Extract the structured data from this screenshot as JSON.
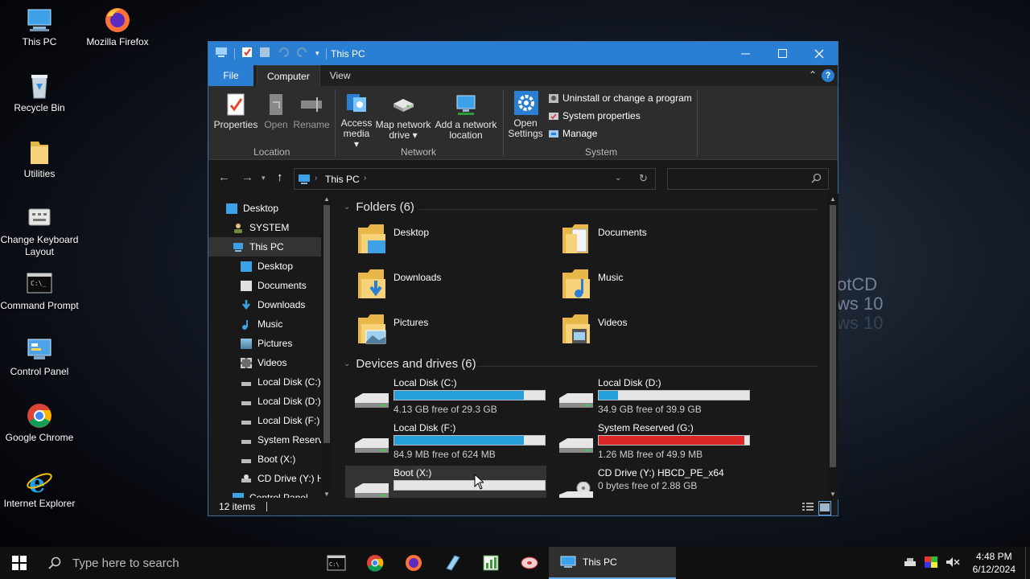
{
  "desktop": {
    "wallpaper_text": [
      "otCD",
      "ws 10",
      "ws 10"
    ],
    "icons": [
      {
        "label": "This PC",
        "icon": "this-pc-icon"
      },
      {
        "label": "Mozilla Firefox",
        "icon": "firefox-icon"
      },
      {
        "label": "Recycle Bin",
        "icon": "recycle-bin-icon"
      },
      {
        "label": "Utilities",
        "icon": "folder-icon"
      },
      {
        "label": "Change Keyboard Layout",
        "icon": "keyboard-icon"
      },
      {
        "label": "Command Prompt",
        "icon": "command-prompt-icon"
      },
      {
        "label": "Control Panel",
        "icon": "control-panel-icon"
      },
      {
        "label": "Google Chrome",
        "icon": "chrome-icon"
      },
      {
        "label": "Internet Explorer",
        "icon": "internet-explorer-icon"
      }
    ]
  },
  "window": {
    "title": "This PC",
    "tabs": {
      "file": "File",
      "computer": "Computer",
      "view": "View"
    },
    "ribbon": {
      "location": {
        "properties": "Properties",
        "open": "Open",
        "rename": "Rename",
        "group": "Location"
      },
      "network": {
        "access_media_1": "Access",
        "access_media_2": "media",
        "map_drive_1": "Map network",
        "map_drive_2": "drive",
        "add_location_1": "Add a network",
        "add_location_2": "location",
        "group": "Network"
      },
      "system": {
        "open_settings_1": "Open",
        "open_settings_2": "Settings",
        "uninstall": "Uninstall or change a program",
        "system_properties": "System properties",
        "manage": "Manage",
        "group": "System"
      }
    },
    "address": {
      "path": "This PC",
      "search_placeholder": ""
    },
    "nav_pane": [
      {
        "label": "Desktop",
        "icon": "desktop-icon"
      },
      {
        "label": "SYSTEM",
        "icon": "user-icon"
      },
      {
        "label": "This PC",
        "icon": "this-pc-icon"
      },
      {
        "label": "Desktop",
        "icon": "desktop-icon"
      },
      {
        "label": "Documents",
        "icon": "documents-icon"
      },
      {
        "label": "Downloads",
        "icon": "downloads-icon"
      },
      {
        "label": "Music",
        "icon": "music-icon"
      },
      {
        "label": "Pictures",
        "icon": "pictures-icon"
      },
      {
        "label": "Videos",
        "icon": "videos-icon"
      },
      {
        "label": "Local Disk (C:)",
        "icon": "drive-icon"
      },
      {
        "label": "Local Disk (D:)",
        "icon": "drive-icon"
      },
      {
        "label": "Local Disk (F:)",
        "icon": "drive-icon"
      },
      {
        "label": "System Reserve",
        "icon": "drive-icon"
      },
      {
        "label": "Boot (X:)",
        "icon": "drive-icon"
      },
      {
        "label": "CD Drive (Y:) H",
        "icon": "cd-drive-icon"
      },
      {
        "label": "Control Panel",
        "icon": "control-panel-icon"
      }
    ],
    "folders_header": "Folders (6)",
    "folders": [
      {
        "label": "Desktop",
        "icon": "desktop-folder-icon"
      },
      {
        "label": "Documents",
        "icon": "documents-folder-icon"
      },
      {
        "label": "Downloads",
        "icon": "downloads-folder-icon"
      },
      {
        "label": "Music",
        "icon": "music-folder-icon"
      },
      {
        "label": "Pictures",
        "icon": "pictures-folder-icon"
      },
      {
        "label": "Videos",
        "icon": "videos-folder-icon"
      }
    ],
    "drives_header": "Devices and drives (6)",
    "drives": [
      {
        "name": "Local Disk (C:)",
        "free": "4.13 GB free of 29.3 GB",
        "used_fraction": 0.86,
        "color": "#26a0da"
      },
      {
        "name": "Local Disk (D:)",
        "free": "34.9 GB free of 39.9 GB",
        "used_fraction": 0.13,
        "color": "#26a0da"
      },
      {
        "name": "Local Disk (F:)",
        "free": "84.9 MB free of 624 MB",
        "used_fraction": 0.86,
        "color": "#26a0da"
      },
      {
        "name": "System Reserved (G:)",
        "free": "1.26 MB free of 49.9 MB",
        "used_fraction": 0.97,
        "color": "#da2626"
      },
      {
        "name": "Boot (X:)",
        "free": "",
        "used_fraction": 0.0,
        "color": "#26a0da"
      },
      {
        "name": "CD Drive (Y:) HBCD_PE_x64",
        "free": "0 bytes free of 2.88 GB",
        "used_fraction": null,
        "color": ""
      }
    ],
    "status": "12 items"
  },
  "taskbar": {
    "search_placeholder": "Type here to search",
    "active_app": "This PC",
    "time": "4:48 PM",
    "date": "6/12/2024"
  }
}
